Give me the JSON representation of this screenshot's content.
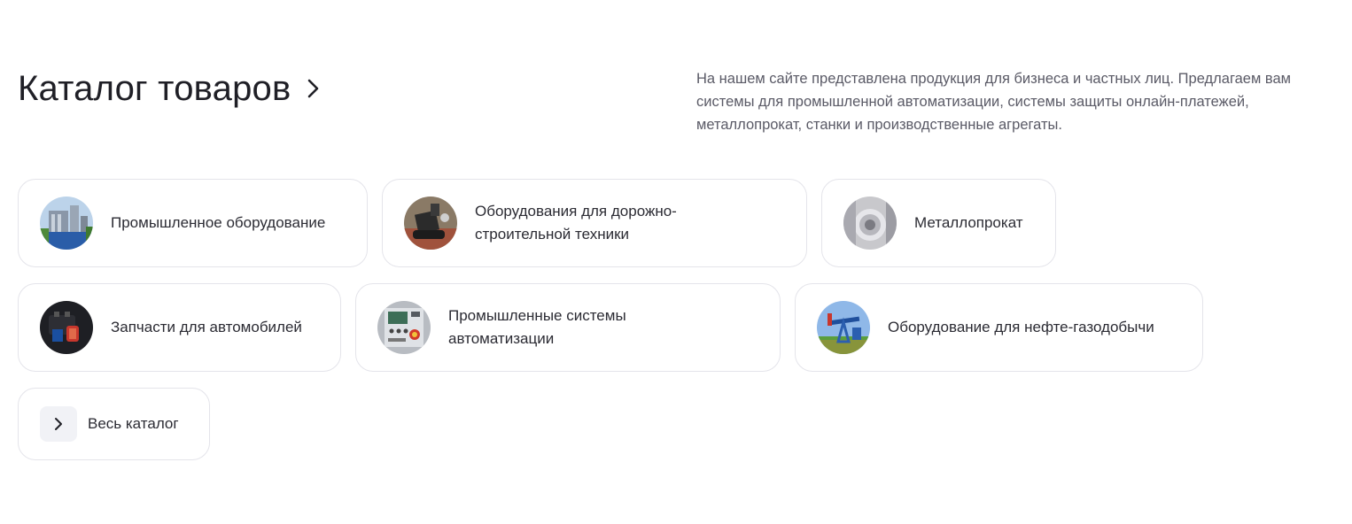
{
  "header": {
    "title": "Каталог товаров",
    "description": "На нашем сайте представлена продукция для бизнеса и частных лиц. Предлагаем вам системы для промышленной автоматизации, системы защиты онлайн-платежей, металлопрокат, станки и производственные агрегаты."
  },
  "categories": [
    {
      "label": "Промышленное оборудование",
      "icon": "industrial-plant-photo"
    },
    {
      "label": "Оборудования для дорожно-строительной техники",
      "icon": "road-machinery-photo"
    },
    {
      "label": "Металлопрокат",
      "icon": "metal-coil-photo"
    },
    {
      "label": "Запчасти для автомобилей",
      "icon": "car-parts-photo"
    },
    {
      "label": "Промышленные системы автоматизации",
      "icon": "control-panel-photo"
    },
    {
      "label": "Оборудование для нефте-газодобычи",
      "icon": "oil-pump-photo"
    }
  ],
  "all_catalog": {
    "label": "Весь каталог",
    "icon": "chevron-right-icon"
  },
  "colors": {
    "border": "#e4e4ea",
    "text": "#2b2b33",
    "muted": "#5a5a66",
    "button_bg": "#f1f2f6"
  }
}
